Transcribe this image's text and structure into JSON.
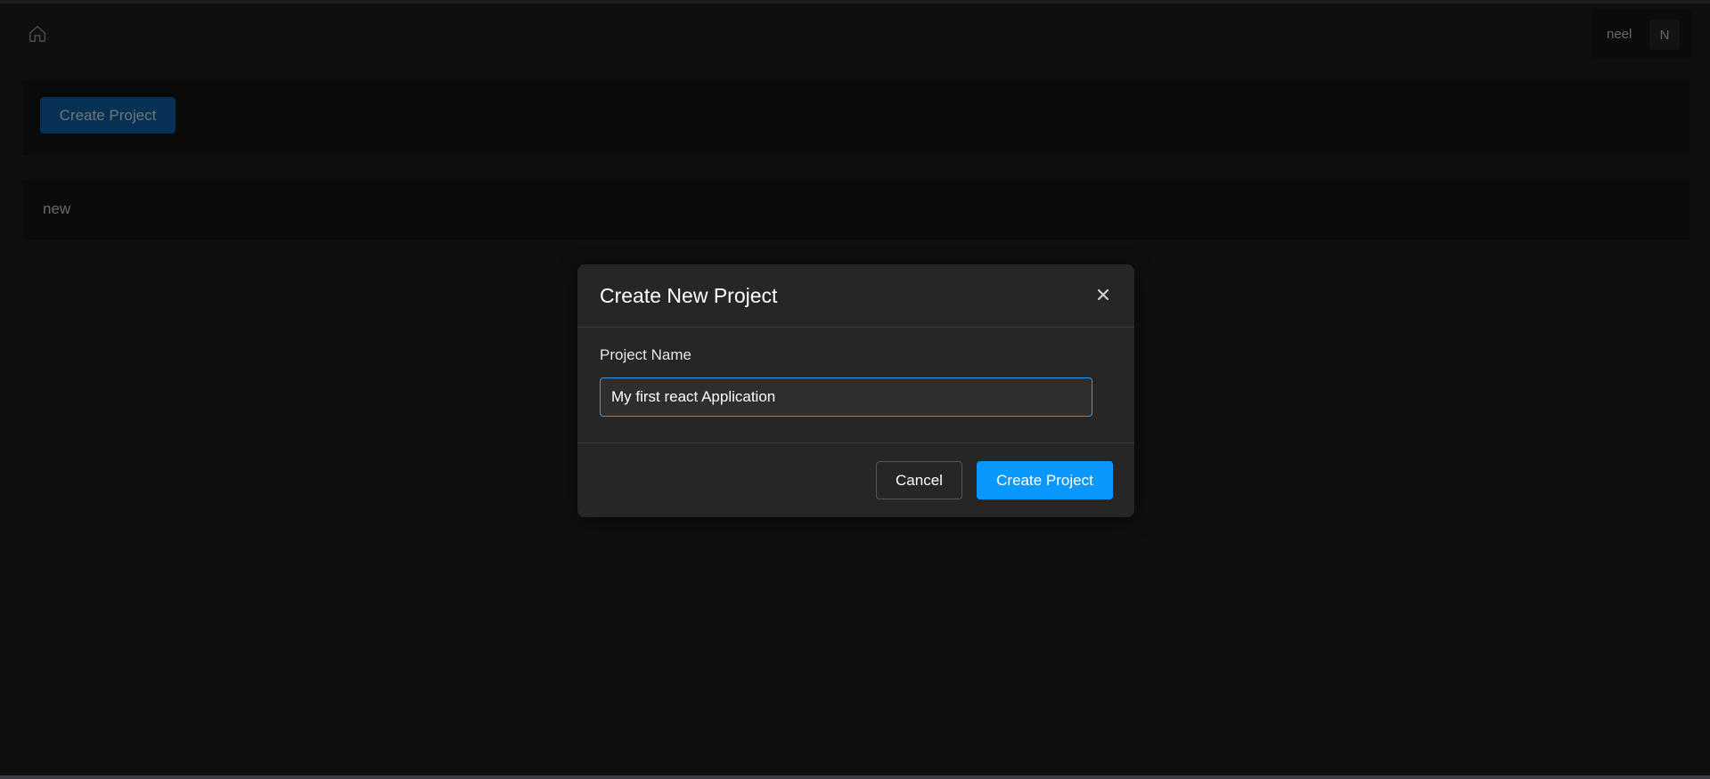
{
  "header": {
    "home_icon": "home-icon",
    "user": {
      "name": "neel",
      "avatar_initial": "N"
    }
  },
  "toolbar": {
    "create_button_label": "Create Project"
  },
  "projects": [
    {
      "name": "new"
    }
  ],
  "modal": {
    "title": "Create New Project",
    "close_icon": "close-icon",
    "field_label": "Project Name",
    "field_value": "My first react Application",
    "cancel_label": "Cancel",
    "submit_label": "Create Project"
  },
  "colors": {
    "accent": "#0a98ff",
    "background": "#1e1e1e",
    "modal_bg": "#262626"
  }
}
